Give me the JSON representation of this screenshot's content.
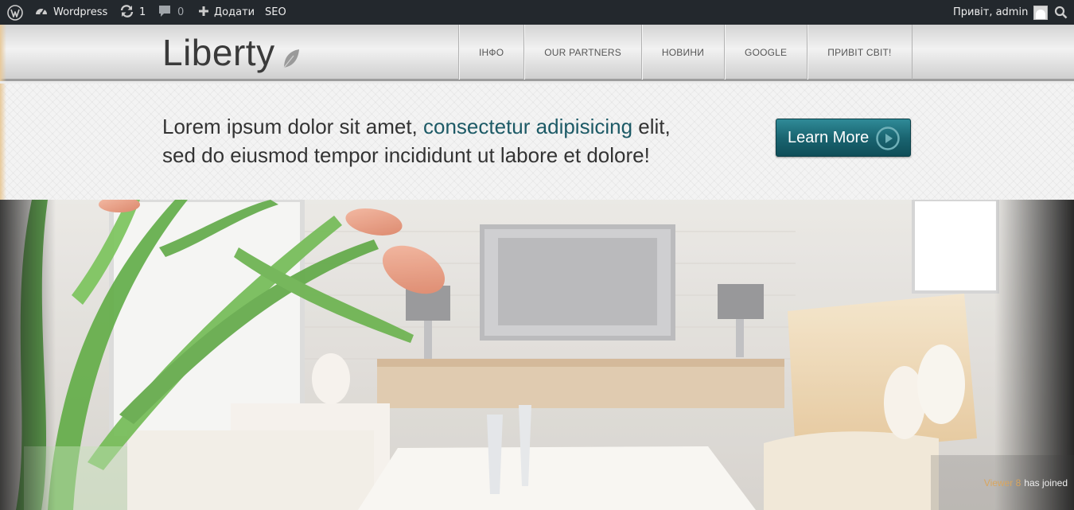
{
  "adminbar": {
    "site_name": "Wordpress",
    "updates_count": "1",
    "comments_count": "0",
    "new_label": "Додати",
    "seo_label": "SEO",
    "greeting": "Привіт, admin",
    "icons": [
      "wordpress-logo-icon",
      "dashboard-icon",
      "refresh-icon",
      "comment-icon",
      "plus-icon",
      "avatar",
      "search-icon"
    ]
  },
  "header": {
    "logo_text": "Liberty",
    "nav": [
      {
        "label": "ІНФО"
      },
      {
        "label": "OUR PARTNERS"
      },
      {
        "label": "НОВИНИ"
      },
      {
        "label": "GOOGLE"
      },
      {
        "label": "ПРИВІТ СВІТ!"
      }
    ]
  },
  "tagline": {
    "part1": "Lorem ipsum dolor sit amet, ",
    "highlight": "consectetur adipisicing",
    "part2": " elit,",
    "line2": "sed do eiusmod tempor incididunt ut labore et dolore!",
    "button_label": "Learn More"
  },
  "notice": {
    "prefix": "Viewer 8",
    "suffix": "has joined"
  },
  "colors": {
    "adminbar_bg": "#23282d",
    "accent": "#1d5a66",
    "button": "#1a6571"
  }
}
